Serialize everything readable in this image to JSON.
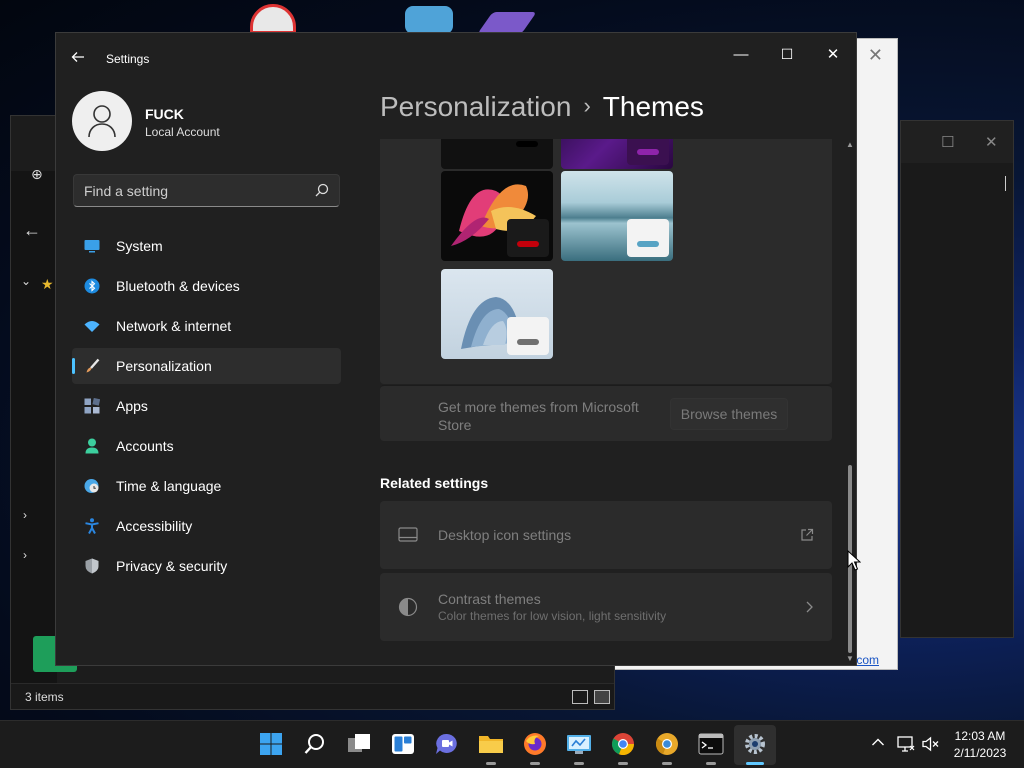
{
  "window": {
    "title": "Settings",
    "controls": {
      "minimize": "—",
      "maximize": "☐",
      "close": "✕"
    }
  },
  "user": {
    "name": "FUCK",
    "account_type": "Local Account"
  },
  "search": {
    "placeholder": "Find a setting"
  },
  "nav": {
    "items": [
      {
        "label": "System",
        "icon": "monitor-icon",
        "color": "#3aa0e8"
      },
      {
        "label": "Bluetooth & devices",
        "icon": "bluetooth-icon",
        "color": "#1d8be0"
      },
      {
        "label": "Network & internet",
        "icon": "wifi-icon",
        "color": "#4cb4ff"
      },
      {
        "label": "Personalization",
        "icon": "brush-icon",
        "color": "#e39b5c",
        "active": true
      },
      {
        "label": "Apps",
        "icon": "apps-icon",
        "color": "#8fa4c4"
      },
      {
        "label": "Accounts",
        "icon": "person-icon",
        "color": "#3ccf9e"
      },
      {
        "label": "Time & language",
        "icon": "globe-clock-icon",
        "color": "#4aa8e8"
      },
      {
        "label": "Accessibility",
        "icon": "accessibility-icon",
        "color": "#2a86e0"
      },
      {
        "label": "Privacy & security",
        "icon": "shield-icon",
        "color": "#9aa0a6"
      }
    ]
  },
  "header": {
    "parent": "Personalization",
    "separator": "›",
    "current": "Themes"
  },
  "themes": {
    "colors": {
      "glow_accent": "#7b1fa2",
      "glow_bar": "#8e24aa",
      "flow_accent": "#c2000b",
      "sunrise_bar": "#57a3c4",
      "bloom_bar": "#707070"
    }
  },
  "store": {
    "text": "Get more themes from Microsoft Store",
    "button": "Browse themes"
  },
  "related": {
    "title": "Related settings",
    "desktop_icons": {
      "title": "Desktop icon settings",
      "icon": "desktop-icon",
      "end_icon": "open-external-icon"
    },
    "contrast": {
      "title": "Contrast themes",
      "subtitle": "Color themes for low vision, light sensitivity",
      "icon": "contrast-icon",
      "end_icon": "chevron-right-icon"
    }
  },
  "explorer": {
    "status": "3 items"
  },
  "background_window": {
    "link_fragment": "com"
  },
  "taskbar": {
    "icons": [
      "start-icon",
      "search-icon",
      "task-view-icon",
      "widgets-icon",
      "chat-icon",
      "file-explorer-icon",
      "firefox-icon",
      "control-panel-icon",
      "chrome-icon",
      "chrome-canary-icon",
      "terminal-icon",
      "settings-icon"
    ],
    "time": "12:03 AM",
    "date": "2/11/2023"
  }
}
